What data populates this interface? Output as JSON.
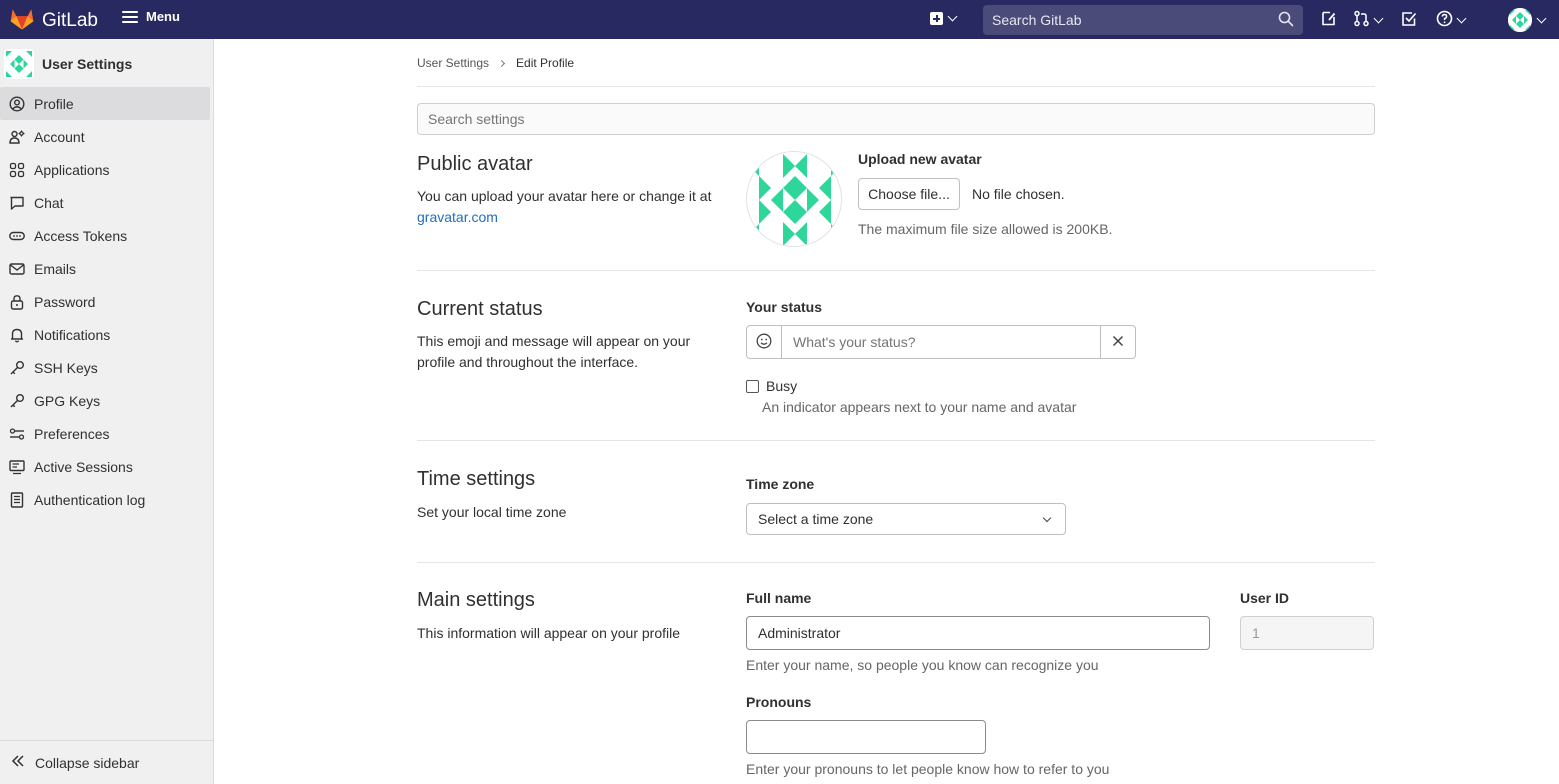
{
  "app": {
    "name": "GitLab",
    "menu_label": "Menu",
    "search_placeholder": "Search GitLab"
  },
  "sidebar": {
    "title": "User Settings",
    "items": [
      {
        "label": "Profile",
        "icon": "profile-icon",
        "active": true
      },
      {
        "label": "Account",
        "icon": "account-icon"
      },
      {
        "label": "Applications",
        "icon": "applications-icon"
      },
      {
        "label": "Chat",
        "icon": "chat-icon"
      },
      {
        "label": "Access Tokens",
        "icon": "token-icon"
      },
      {
        "label": "Emails",
        "icon": "mail-icon"
      },
      {
        "label": "Password",
        "icon": "lock-icon"
      },
      {
        "label": "Notifications",
        "icon": "bell-icon"
      },
      {
        "label": "SSH Keys",
        "icon": "key-icon"
      },
      {
        "label": "GPG Keys",
        "icon": "key-icon"
      },
      {
        "label": "Preferences",
        "icon": "preferences-icon"
      },
      {
        "label": "Active Sessions",
        "icon": "monitor-icon"
      },
      {
        "label": "Authentication log",
        "icon": "log-icon"
      }
    ],
    "collapse_label": "Collapse sidebar"
  },
  "breadcrumb": {
    "parent": "User Settings",
    "current": "Edit Profile"
  },
  "search_settings_placeholder": "Search settings",
  "avatar_section": {
    "title": "Public avatar",
    "description": "You can upload your avatar here or change it at",
    "link": "gravatar.com",
    "upload_label": "Upload new avatar",
    "choose_button": "Choose file...",
    "no_file": "No file chosen.",
    "max_size": "The maximum file size allowed is 200KB."
  },
  "status_section": {
    "title": "Current status",
    "description": "This emoji and message will appear on your profile and throughout the interface.",
    "label": "Your status",
    "placeholder": "What's your status?",
    "busy_label": "Busy",
    "busy_help": "An indicator appears next to your name and avatar"
  },
  "time_section": {
    "title": "Time settings",
    "description": "Set your local time zone",
    "label": "Time zone",
    "select_value": "Select a time zone"
  },
  "main_section": {
    "title": "Main settings",
    "description": "This information will appear on your profile",
    "full_name_label": "Full name",
    "full_name_value": "Administrator",
    "full_name_help": "Enter your name, so people you know can recognize you",
    "user_id_label": "User ID",
    "user_id_value": "1",
    "pronouns_label": "Pronouns",
    "pronouns_value": "",
    "pronouns_help": "Enter your pronouns to let people know how to refer to you"
  },
  "colors": {
    "navbar": "#292961",
    "sidebar": "#f0f0f0",
    "avatar_green": "#2ed69a",
    "link": "#1f6fbf"
  }
}
